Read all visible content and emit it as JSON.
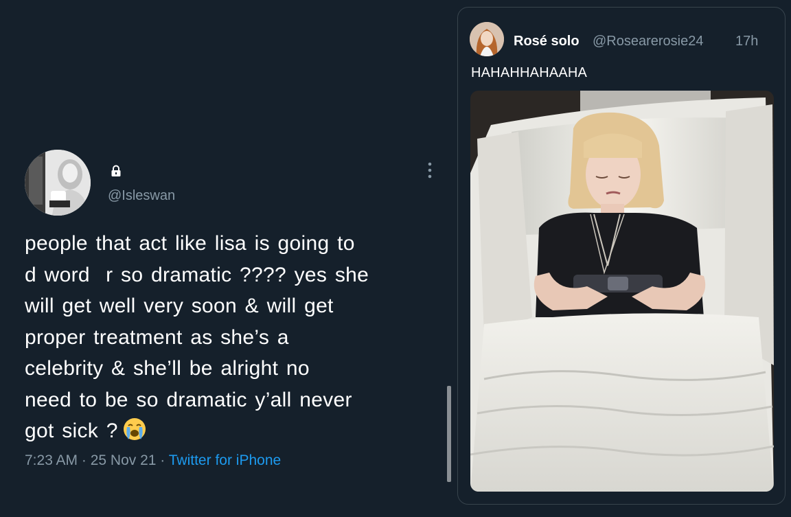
{
  "main_tweet": {
    "handle": "@Isleswan",
    "text_lines": [
      "people that act like lisa is going to",
      "d word  r so dramatic ???? yes she",
      "will get well very soon & will get",
      "proper treatment as she’s a",
      "celebrity & she’ll be alright no",
      "need to be so dramatic y’all never",
      "got sick ?"
    ],
    "time": "7:23 AM",
    "date": "25 Nov 21",
    "source": "Twitter for iPhone",
    "separator": " · ",
    "emoji": "loudly-crying-face-icon"
  },
  "quoted_tweet": {
    "name": "Rosé solo",
    "handle": "@Rosearerosie24",
    "time": "17h",
    "text": "HAHAHHAHAAHA"
  },
  "colors": {
    "background": "#15202b",
    "text": "#ffffff",
    "secondary_text": "#8899a6",
    "link": "#1d9bf0",
    "border": "#38444d"
  }
}
